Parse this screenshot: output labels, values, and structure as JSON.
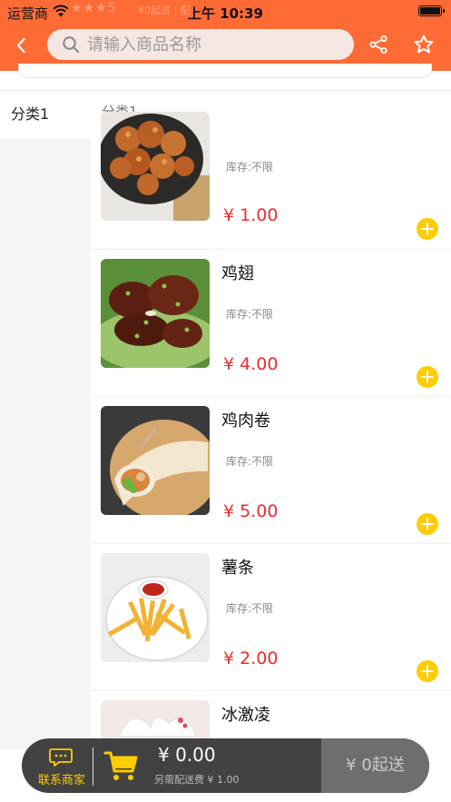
{
  "status_bar": {
    "carrier": "运营商",
    "time": "上午 10:39"
  },
  "shop_ghost": {
    "rating_value": "5",
    "min_order_text": "¥0起送 | 配"
  },
  "search": {
    "placeholder": "请输入商品名称"
  },
  "sidebar": {
    "items": [
      {
        "label": "分类1",
        "selected": true
      }
    ]
  },
  "category": {
    "title": "分类1"
  },
  "products": [
    {
      "name": "",
      "stock": "库存:不限",
      "price": "¥ 1.00",
      "image": "fried-chicken-popcorn"
    },
    {
      "name": "鸡翅",
      "stock": "库存:不限",
      "price": "¥ 4.00",
      "image": "chicken-wings"
    },
    {
      "name": "鸡肉卷",
      "stock": "库存:不限",
      "price": "¥ 5.00",
      "image": "chicken-wrap"
    },
    {
      "name": "薯条",
      "stock": "库存:不限",
      "price": "¥ 2.00",
      "image": "french-fries"
    },
    {
      "name": "冰激凌",
      "stock": "",
      "price": "",
      "image": "ice-cream"
    }
  ],
  "cart": {
    "contact_label": "联系商家",
    "total": "¥ 0.00",
    "delivery_fee": "另需配送费 ¥ 1.00",
    "checkout_label": "¥ 0起送"
  },
  "colors": {
    "brand": "#FF6B35",
    "accent": "#FFCC00",
    "price": "#EE2C2C"
  }
}
